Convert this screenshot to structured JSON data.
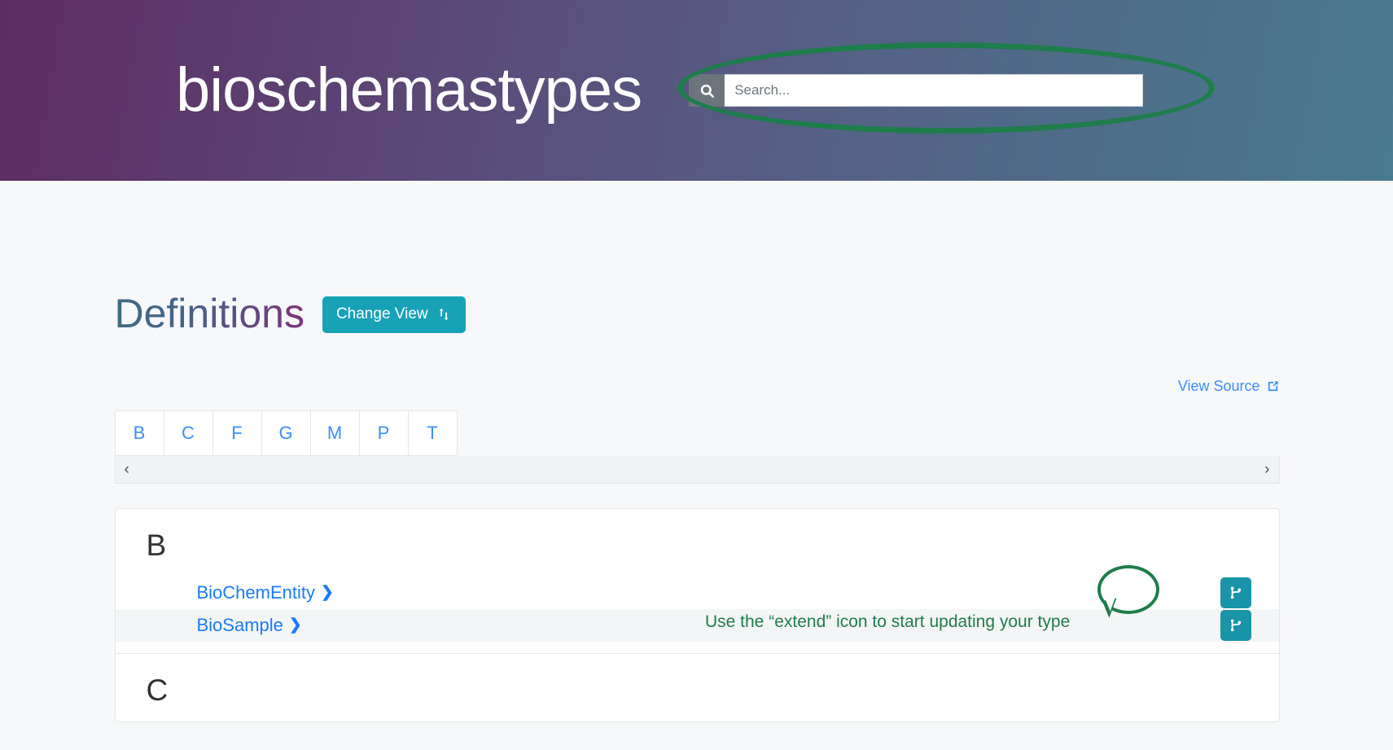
{
  "header": {
    "site_title": "bioschemastypes",
    "search": {
      "placeholder": "Search...",
      "value": "",
      "button_icon": "search-icon",
      "button_label": ""
    },
    "gradient_start": "#5d2d62",
    "gradient_end": "#4a7a8e"
  },
  "main": {
    "page_title": "Definitions",
    "change_view_label": "Change View",
    "change_view_icon": "exchange-arrows-icon",
    "change_view_color": "#17a2b8",
    "view_source_label": "View Source",
    "view_source_icon": "external-link-icon",
    "link_color": "#3c8dfd"
  },
  "letter_nav": {
    "letters": [
      "B",
      "C",
      "F",
      "G",
      "M",
      "P",
      "T"
    ],
    "scroll_left_icon": "chevron-left-icon",
    "scroll_right_icon": "chevron-right-icon",
    "scroll_left_glyph": "‹",
    "scroll_right_glyph": "›"
  },
  "definitions": {
    "groups": [
      {
        "letter": "B",
        "types": [
          {
            "name": "BioChemEntity",
            "chevron": "❯",
            "extend_icon": "extend-branch-icon"
          },
          {
            "name": "BioSample",
            "chevron": "❯",
            "extend_icon": "extend-branch-icon"
          }
        ]
      },
      {
        "letter": "C",
        "types": []
      }
    ]
  },
  "annotations": {
    "search_highlight_shape": "ellipse",
    "search_highlight_color": "#1d7d4b",
    "callout_shape": "speech-bubble-circle",
    "callout_color": "#1d7d4b",
    "instruction_text": "Use the “extend” icon to start updating your type"
  }
}
